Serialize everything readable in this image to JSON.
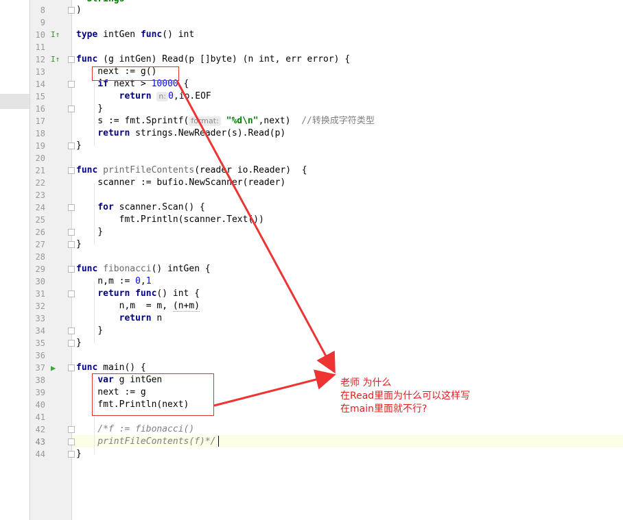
{
  "lines": [
    {
      "n": "8",
      "code": ")"
    },
    {
      "n": "9",
      "code": ""
    },
    {
      "n": "10",
      "kw1": "type",
      "rest": " intGen ",
      "kw2": "func",
      "rest2": "() int"
    },
    {
      "n": "11",
      "code": ""
    },
    {
      "n": "12",
      "kw1": "func",
      "rest": " (g intGen) Read(p []byte) (n int, err error) {"
    },
    {
      "n": "13",
      "code": "    next := g()"
    },
    {
      "n": "14",
      "indent": "    ",
      "kw": "if",
      "mid": " next > ",
      "num": "10000",
      "tail": " {"
    },
    {
      "n": "15",
      "indent": "        ",
      "kw": "return",
      "hint": "n:",
      "num": "0",
      "tail": ",io.EOF"
    },
    {
      "n": "16",
      "code": "    }"
    },
    {
      "n": "17",
      "pre": "    s := fmt.Sprintf(",
      "hint": "format:",
      "str": "\"%d\\n\"",
      "post": ",next)  ",
      "cmt": "//转换成字符类型"
    },
    {
      "n": "18",
      "indent": "    ",
      "kw": "return",
      "tail": " strings.NewReader(s).Read(p)"
    },
    {
      "n": "19",
      "code": "}"
    },
    {
      "n": "20",
      "code": ""
    },
    {
      "n": "21",
      "kw": "func",
      "dim": " printFileContents",
      "tail": "(reader io.Reader)  {"
    },
    {
      "n": "22",
      "code": "    scanner := bufio.NewScanner(reader)"
    },
    {
      "n": "23",
      "code": ""
    },
    {
      "n": "24",
      "indent": "    ",
      "kw": "for",
      "tail": " scanner.Scan() {"
    },
    {
      "n": "25",
      "code": "        fmt.Println(scanner.Text())"
    },
    {
      "n": "26",
      "code": "    }"
    },
    {
      "n": "27",
      "code": "}"
    },
    {
      "n": "28",
      "code": ""
    },
    {
      "n": "29",
      "kw": "func",
      "dim": " fibonacci",
      "tail": "() intGen {"
    },
    {
      "n": "30",
      "pre": "    n,m := ",
      "num1": "0",
      "sep": ",",
      "num2": "1"
    },
    {
      "n": "31",
      "indent": "    ",
      "kw": "return",
      "mid": " ",
      "kw2": "func",
      "tail": "() int {"
    },
    {
      "n": "32",
      "pre": "        n,m  = m, ",
      "ul": "(n+m)"
    },
    {
      "n": "33",
      "indent": "        ",
      "kw": "return",
      "tail": " n"
    },
    {
      "n": "34",
      "code": "    }"
    },
    {
      "n": "35",
      "code": "}"
    },
    {
      "n": "36",
      "code": ""
    },
    {
      "n": "37",
      "kw": "func",
      "tail": " main() {"
    },
    {
      "n": "38",
      "indent": "    ",
      "kw": "var",
      "tail": " g intGen"
    },
    {
      "n": "39",
      "code": "    next := g"
    },
    {
      "n": "40",
      "code": "    fmt.Println(next)"
    },
    {
      "n": "41",
      "code": ""
    },
    {
      "n": "42",
      "cmt": "    /*f := fibonacci()"
    },
    {
      "n": "43",
      "cmt": "    printFileContents(f)*/"
    },
    {
      "n": "44",
      "code": "}"
    }
  ],
  "top_partial_text": "  Strings",
  "annotation": {
    "line1": "老师 为什么",
    "line2": "在Read里面为什么可以这样写",
    "line3": "在main里面就不行?"
  },
  "colors": {
    "keyword": "#000080",
    "number": "#0000ff",
    "string": "#008000",
    "comment": "#808080",
    "annotation": "#e02020"
  },
  "gutter_icons": {
    "line10": "implemented-up-icon",
    "line12": "implemented-up-icon",
    "line37": "run-triangle-icon"
  }
}
